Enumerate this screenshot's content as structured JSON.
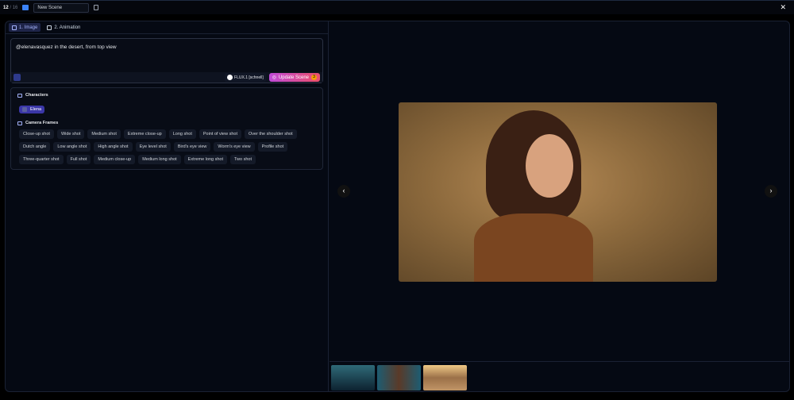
{
  "topbar": {
    "current": "12",
    "total": "/ 16",
    "scene_name": "New Scene"
  },
  "tabs": [
    {
      "label": "1. Image"
    },
    {
      "label": "2. Animation"
    }
  ],
  "prompt": {
    "text": "@elenavasquez in the desert, from top view",
    "model": "FLUX.1 [schnell]",
    "update_label": "Update Scene",
    "update_cost": "3"
  },
  "characters": {
    "title": "Characters",
    "items": [
      "Elena"
    ]
  },
  "camera": {
    "title": "Camera Frames",
    "shots": [
      "Close-up shot",
      "Wide shot",
      "Medium shot",
      "Extreme close-up",
      "Long shot",
      "Point of view shot",
      "Over the shoulder shot",
      "Dutch angle",
      "Low angle shot",
      "High angle shot",
      "Eye level shot",
      "Bird's eye view",
      "Worm's eye view",
      "Profile shot",
      "Three-quarter shot",
      "Full shot",
      "Medium close-up",
      "Medium long shot",
      "Extreme long shot",
      "Two shot"
    ]
  }
}
